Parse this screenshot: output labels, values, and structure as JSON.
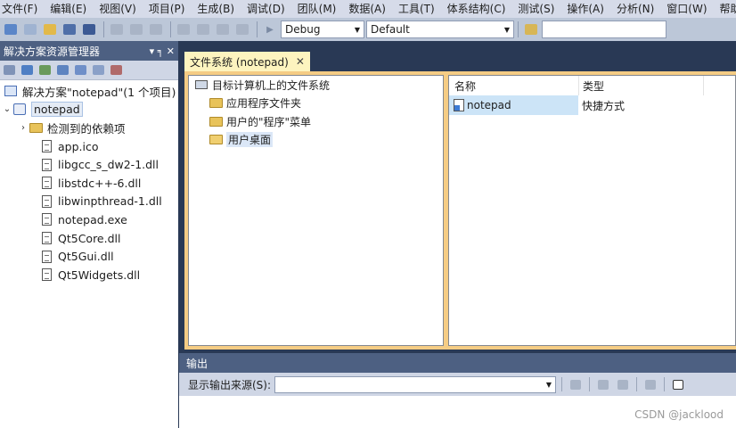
{
  "menubar": {
    "items": [
      "文件(F)",
      "编辑(E)",
      "视图(V)",
      "项目(P)",
      "生成(B)",
      "调试(D)",
      "团队(M)",
      "数据(A)",
      "工具(T)",
      "体系结构(C)",
      "测试(S)",
      "操作(A)",
      "分析(N)",
      "窗口(W)",
      "帮助"
    ]
  },
  "toolbar": {
    "config_value": "Debug",
    "platform_value": "Default",
    "search_value": ""
  },
  "solution_explorer": {
    "title": "解决方案资源管理器",
    "pin_glyph": "▾ ╕ ✕",
    "items": [
      {
        "label": "解决方案\"notepad\"(1 个项目)"
      },
      {
        "label": "notepad"
      },
      {
        "label": "检测到的依赖项"
      },
      {
        "label": "app.ico"
      },
      {
        "label": "libgcc_s_dw2-1.dll"
      },
      {
        "label": "libstdc++-6.dll"
      },
      {
        "label": "libwinpthread-1.dll"
      },
      {
        "label": "notepad.exe"
      },
      {
        "label": "Qt5Core.dll"
      },
      {
        "label": "Qt5Gui.dll"
      },
      {
        "label": "Qt5Widgets.dll"
      }
    ]
  },
  "document": {
    "tab_label": "文件系统 (notepad)",
    "tree": [
      {
        "label": "目标计算机上的文件系统"
      },
      {
        "label": "应用程序文件夹"
      },
      {
        "label": "用户的\"程序\"菜单"
      },
      {
        "label": "用户桌面"
      }
    ],
    "list": {
      "col_name": "名称",
      "col_type": "类型",
      "rows": [
        {
          "name": "notepad",
          "type": "快捷方式"
        }
      ]
    }
  },
  "output": {
    "title": "输出",
    "source_label": "显示输出来源(S):",
    "source_value": ""
  },
  "watermark": "CSDN @jacklood",
  "colors": {
    "ide_background": "#293955",
    "active_doc_border": "#f5cc84",
    "active_tab": "#fdf4bf"
  }
}
